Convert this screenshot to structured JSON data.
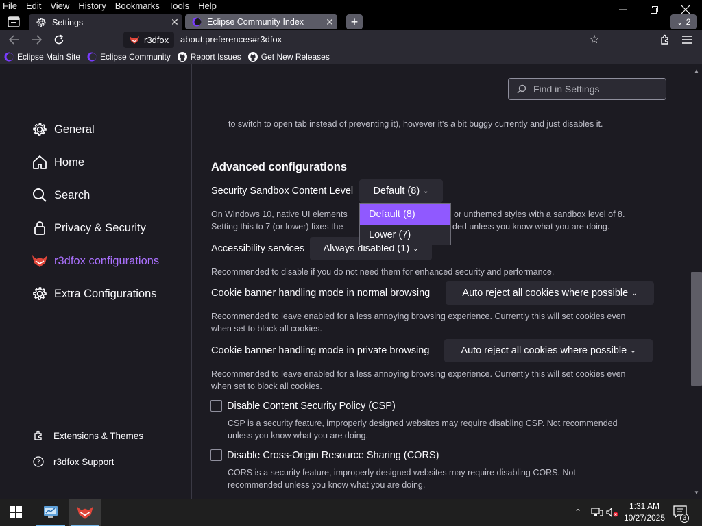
{
  "menu": [
    "File",
    "Edit",
    "View",
    "History",
    "Bookmarks",
    "Tools",
    "Help"
  ],
  "tabs": [
    {
      "title": "Settings",
      "icon": "gear-icon",
      "active": true
    },
    {
      "title": "Eclipse Community Index",
      "icon": "eclipse-icon",
      "active": false
    }
  ],
  "tab_count": "2",
  "urlbar": {
    "identity_label": "r3dfox",
    "url": "about:preferences#r3dfox"
  },
  "bookmarks": [
    {
      "label": "Eclipse Main Site",
      "icon": "eclipse-icon"
    },
    {
      "label": "Eclipse Community",
      "icon": "eclipse-icon"
    },
    {
      "label": "Report Issues",
      "icon": "github-icon"
    },
    {
      "label": "Get New Releases",
      "icon": "github-icon"
    }
  ],
  "sidebar": {
    "categories": [
      {
        "label": "General",
        "icon": "gear-icon"
      },
      {
        "label": "Home",
        "icon": "home-icon"
      },
      {
        "label": "Search",
        "icon": "search-icon"
      },
      {
        "label": "Privacy & Security",
        "icon": "lock-icon"
      },
      {
        "label": "r3dfox configurations",
        "icon": "r3dfox-icon",
        "selected": true
      },
      {
        "label": "Extra Configurations",
        "icon": "gear-icon"
      }
    ],
    "footer": [
      {
        "label": "Extensions & Themes",
        "icon": "puzzle-icon"
      },
      {
        "label": "r3dfox Support",
        "icon": "help-icon"
      }
    ]
  },
  "search": {
    "placeholder": "Find in Settings"
  },
  "main": {
    "top_text": "to switch to open tab instead of preventing it), however it's a bit buggy currently and just disables it.",
    "section_title": "Advanced configurations",
    "sandbox": {
      "label": "Security Sandbox Content Level",
      "value": "Default (8)",
      "desc_line1": "On Windows 10, native UI elements",
      "desc_line1_end": "or unthemed styles with a sandbox level of 8.",
      "desc_line2": "Setting this to 7 (or lower) fixes the",
      "desc_line2_end": "ded unless you know what you are doing."
    },
    "accessibility": {
      "label": "Accessibility services",
      "value": "Always disabled (1)",
      "desc": "Recommended to disable if you do not need them for enhanced security and performance."
    },
    "cookie_normal": {
      "label": "Cookie banner handling mode in normal browsing",
      "value": "Auto reject all cookies where possible",
      "desc_line1": "Recommended to leave enabled for a less annoying browsing experience. Currently this will set cookies even",
      "desc_line2": "when set to block all cookies."
    },
    "cookie_private": {
      "label": "Cookie banner handling mode in private browsing",
      "value": "Auto reject all cookies where possible",
      "desc_line1": "Recommended to leave enabled for a less annoying browsing experience. Currently this will set cookies even",
      "desc_line2": "when set to block all cookies."
    },
    "csp": {
      "label": "Disable Content Security Policy (CSP)",
      "checked": false,
      "desc_line1": "CSP is a security feature, improperly designed websites may require disabling CSP. Not recommended",
      "desc_line2": "unless you know what you are doing."
    },
    "cors": {
      "label": "Disable Cross-Origin Resource Sharing (CORS)",
      "checked": false,
      "desc_line1": "CORS is a security feature, improperly designed websites may require disabling CORS. Not",
      "desc_line2": "recommended unless you know what you are doing."
    }
  },
  "dropdown_popup": {
    "options": [
      {
        "label": "Default (8)",
        "selected": true
      },
      {
        "label": "Lower (7)",
        "selected": false
      }
    ]
  },
  "taskbar": {
    "time": "1:31 AM",
    "date": "10/27/2025",
    "notification_count": "3"
  },
  "colors": {
    "accent": "#9059ff",
    "selected_category": "#ab71ff",
    "content_bg": "#1c1b22",
    "toolbar_bg": "#2b2a33"
  }
}
